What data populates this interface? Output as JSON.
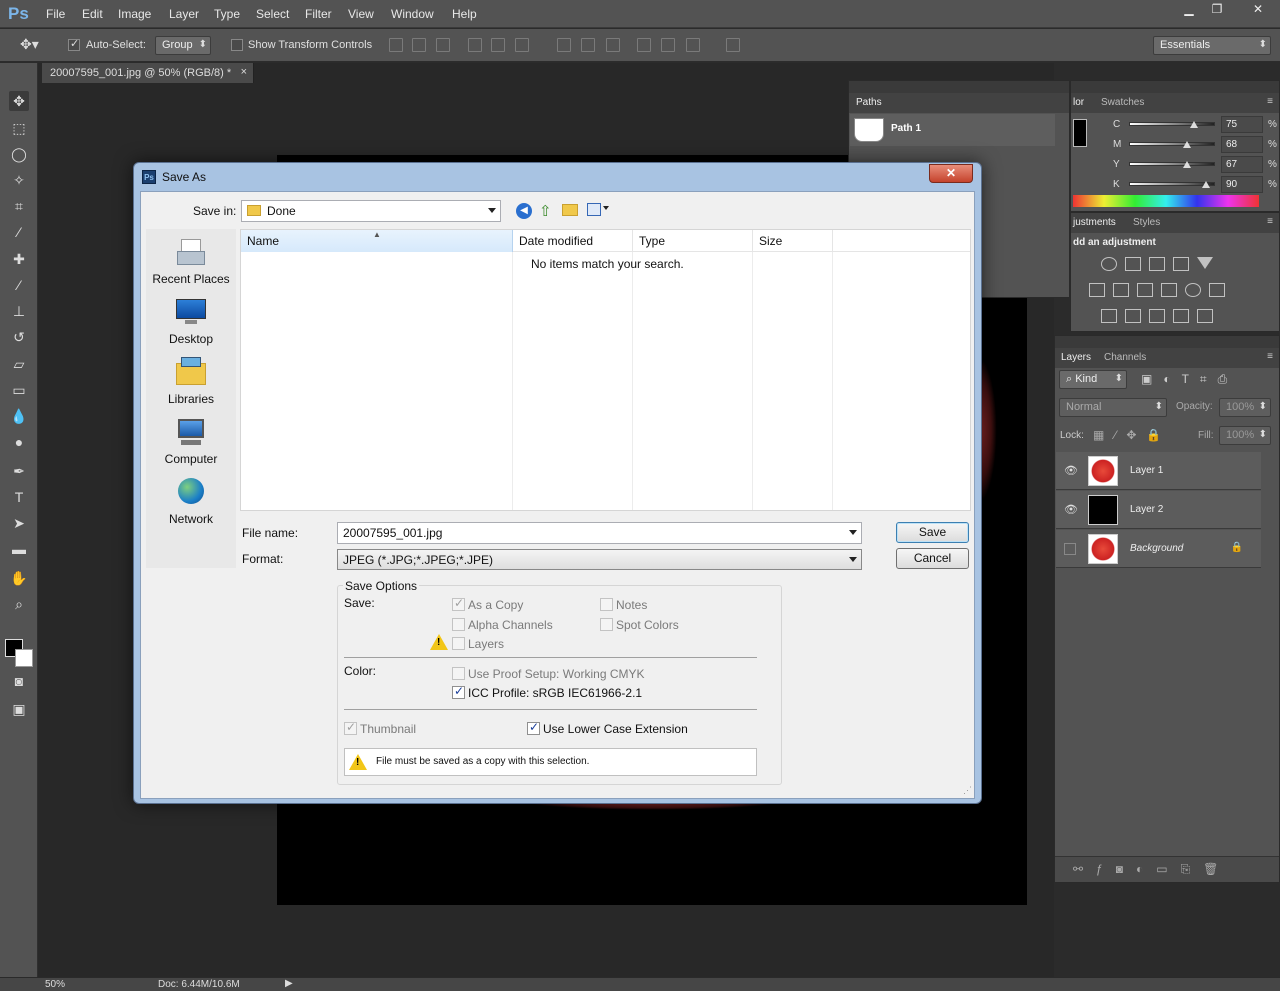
{
  "app": {
    "logo": "Ps"
  },
  "menu": [
    "File",
    "Edit",
    "Image",
    "Layer",
    "Type",
    "Select",
    "Filter",
    "View",
    "Window",
    "Help"
  ],
  "window_controls": {
    "minimize": "▁",
    "restore": "❐",
    "close": "✕"
  },
  "options_bar": {
    "auto_select_label": "Auto-Select:",
    "auto_select_checked": true,
    "auto_select_value": "Group",
    "show_transform_label": "Show Transform Controls",
    "show_transform_checked": false,
    "workspace": "Essentials"
  },
  "document_tab": {
    "title": "20007595_001.jpg @ 50% (RGB/8) *",
    "close": "×"
  },
  "paths_panel": {
    "tab": "Paths",
    "items": [
      {
        "name": "Path 1"
      }
    ]
  },
  "color_panel": {
    "tabs": [
      "lor",
      "Swatches"
    ],
    "sliders": [
      {
        "label": "C",
        "value": "75",
        "level": 0.75
      },
      {
        "label": "M",
        "value": "68",
        "level": 0.68
      },
      {
        "label": "Y",
        "value": "67",
        "level": 0.67
      },
      {
        "label": "K",
        "value": "90",
        "level": 0.9
      }
    ],
    "pct": "%"
  },
  "adjustments_panel": {
    "tabs": [
      "justments",
      "Styles"
    ],
    "title": "dd an adjustment"
  },
  "layers_panel": {
    "tabs": [
      "Layers",
      "Channels"
    ],
    "filter_kind": "Kind",
    "blend_mode": "Normal",
    "opacity_label": "Opacity:",
    "opacity_value": "100%",
    "lock_label": "Lock:",
    "fill_label": "Fill:",
    "fill_value": "100%",
    "layers": [
      {
        "name": "Layer 1",
        "visible": true,
        "thumb": "red"
      },
      {
        "name": "Layer 2",
        "visible": true,
        "thumb": "black"
      },
      {
        "name": "Background",
        "visible": false,
        "thumb": "red",
        "locked": true
      }
    ]
  },
  "status_bar": {
    "zoom": "50%",
    "doc": "Doc: 6.44M/10.6M"
  },
  "save_dialog": {
    "title": "Save As",
    "icon_text": "Ps",
    "close": "✕",
    "save_in_label": "Save in:",
    "save_in_value": "Done",
    "places": [
      "Recent Places",
      "Desktop",
      "Libraries",
      "Computer",
      "Network"
    ],
    "columns": [
      "Name",
      "Date modified",
      "Type",
      "Size"
    ],
    "empty_message": "No items match your search.",
    "file_name_label": "File name:",
    "file_name_value": "20007595_001.jpg",
    "format_label": "Format:",
    "format_value": "JPEG (*.JPG;*.JPEG;*.JPE)",
    "save_button": "Save",
    "cancel_button": "Cancel",
    "save_options_title": "Save Options",
    "save_label": "Save:",
    "options": {
      "as_a_copy": {
        "label": "As a Copy",
        "checked": true,
        "disabled": true
      },
      "notes": {
        "label": "Notes",
        "checked": false,
        "disabled": true
      },
      "alpha_channels": {
        "label": "Alpha Channels",
        "checked": false,
        "disabled": true
      },
      "spot_colors": {
        "label": "Spot Colors",
        "checked": false,
        "disabled": true
      },
      "layers": {
        "label": "Layers",
        "checked": false,
        "disabled": true
      }
    },
    "color_label": "Color:",
    "use_proof_setup": {
      "label": "Use Proof Setup:  Working CMYK",
      "checked": false,
      "disabled": true
    },
    "icc_profile": {
      "label": "ICC Profile:  sRGB IEC61966-2.1",
      "checked": true,
      "disabled": false
    },
    "thumbnail": {
      "label": "Thumbnail",
      "checked": true,
      "disabled": true
    },
    "lower_case_ext": {
      "label": "Use Lower Case Extension",
      "checked": true,
      "disabled": false
    },
    "warning": "File must be saved as a copy with this selection."
  }
}
